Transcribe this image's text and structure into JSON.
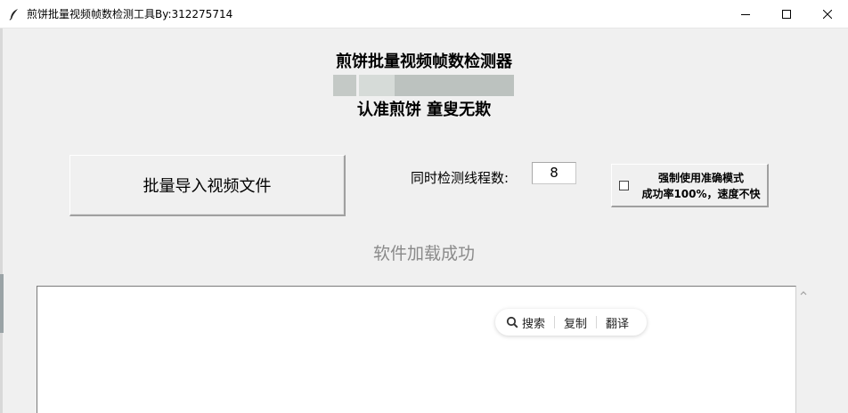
{
  "window": {
    "title": "煎饼批量视频帧数检测工具By:312275714",
    "icons": {
      "app": "feather-icon",
      "minimize": "minimize-icon",
      "maximize": "maximize-icon",
      "close": "close-icon"
    }
  },
  "header": {
    "title": "煎饼批量视频帧数检测器",
    "slogan": "认准煎饼 童叟无欺"
  },
  "controls": {
    "import_button_label": "批量导入视频文件",
    "thread_label": "同时检测线程数:",
    "thread_value": "8",
    "mode_checkbox": {
      "line1": "强制使用准确模式",
      "line2": "成功率100%，速度不快",
      "checked": false
    }
  },
  "status": {
    "text": "软件加载成功"
  },
  "context_toolbar": {
    "search_label": "搜索",
    "copy_label": "复制",
    "translate_label": "翻译"
  },
  "colors": {
    "background": "#f0f0f0",
    "status_text": "#8a8a8a",
    "redaction": "#bfc5c2"
  }
}
